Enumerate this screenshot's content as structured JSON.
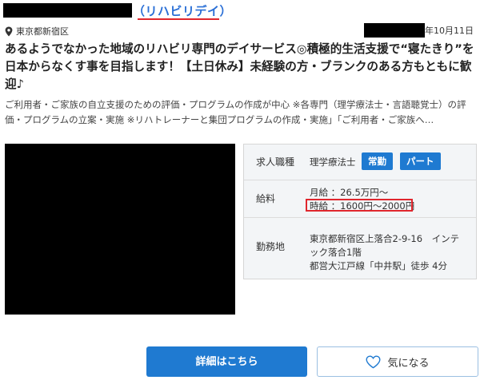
{
  "listing": {
    "facility_name_tail": "（リハビリデイ）",
    "location": "東京都新宿区",
    "date_suffix": "年10月11日",
    "headline": "あるようでなかった地域のリハビリ専門のデイサービス◎積極的生活支援で“寝たきり”を日本からなくす事を目指します！【土日休み】未経験の方・ブランクのある方もともに歓迎♪",
    "description": "ご利用者・ご家族の自立支援のための評価・プログラムの作成が中心 ※各専門（理学療法士・言語聴覚士）の評価・プログラムの立案・実施 ※リハトレーナーと集団プログラムの作成・実施」「ご利用者・ご家族へ…"
  },
  "info_table": {
    "job_type_label": "求人職種",
    "job_type_value": "理学療法士",
    "tags": [
      "常勤",
      "パート"
    ],
    "salary_label": "給料",
    "salary_monthly": "月給 ：26.5万円〜",
    "salary_hourly": "時給 ：1600円〜2000円",
    "location_label": "勤務地",
    "address_line1": "東京都新宿区上落合2-9-16　インテ",
    "address_line2": "ック落合1階",
    "access": "都営大江戸線「中井駅」徒歩 4分"
  },
  "actions": {
    "detail_label": "詳細はこちら",
    "favorite_label": "気になる"
  },
  "colors": {
    "accent_blue": "#1f7ad1",
    "link_blue": "#2a6fd6",
    "highlight_red": "#e0262d"
  },
  "icons": {
    "location": "map-pin-icon",
    "favorite": "heart-outline-icon"
  }
}
